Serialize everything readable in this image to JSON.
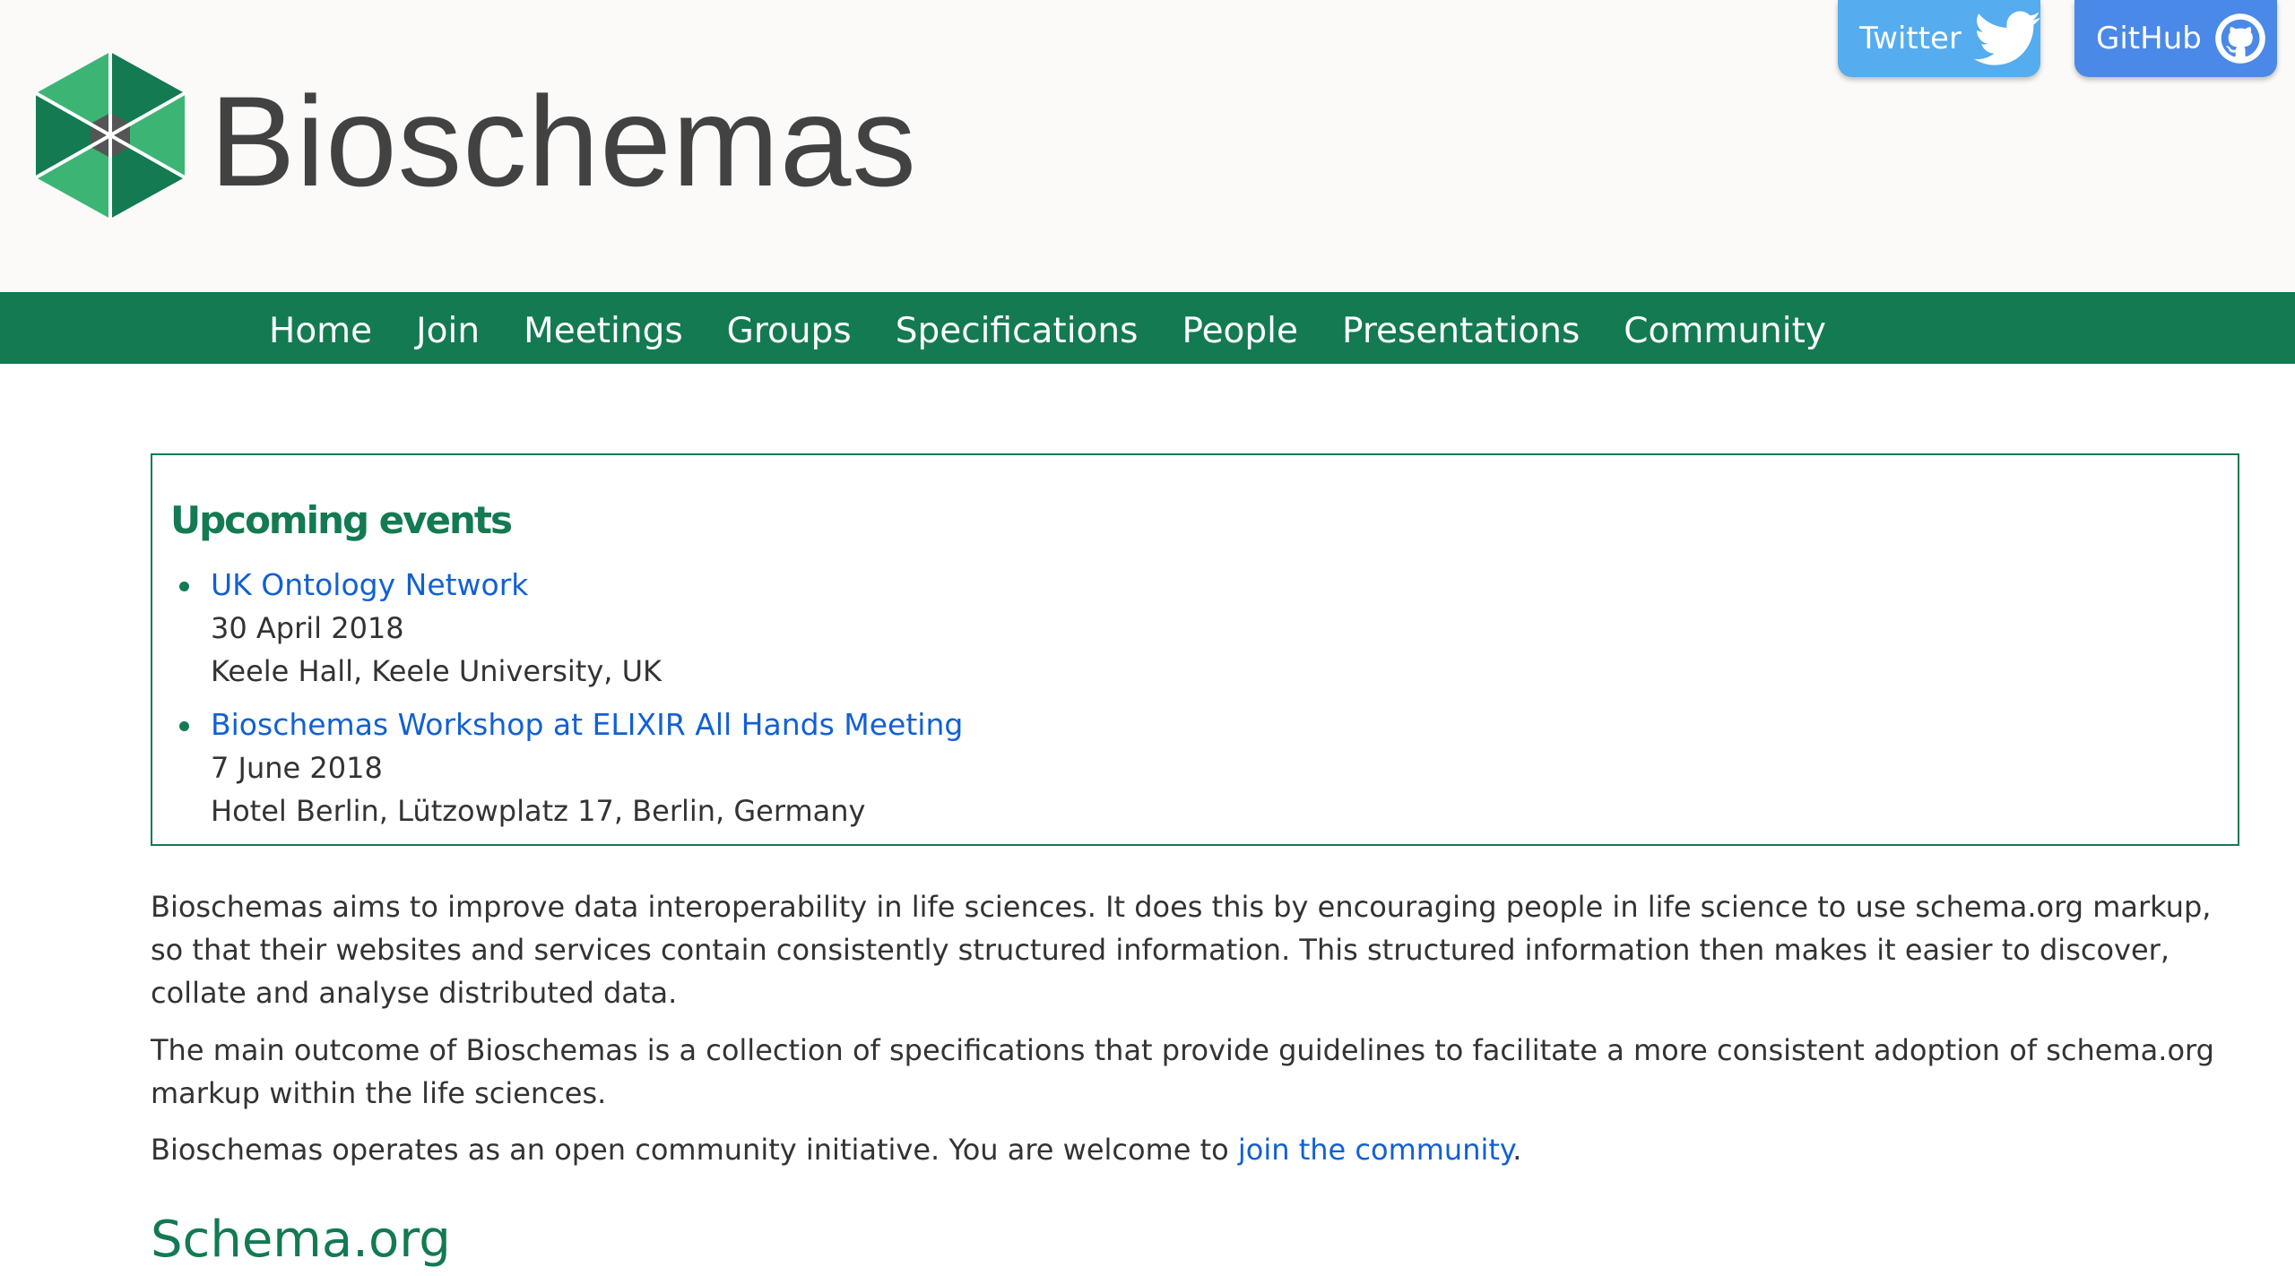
{
  "header": {
    "brand": "Bioschemas",
    "twitter_label": "Twitter",
    "github_label": "GitHub"
  },
  "nav": {
    "items": [
      "Home",
      "Join",
      "Meetings",
      "Groups",
      "Specifications",
      "People",
      "Presentations",
      "Community"
    ]
  },
  "events": {
    "title": "Upcoming events",
    "items": [
      {
        "title": "UK Ontology Network",
        "date": "30 April 2018",
        "location": "Keele Hall, Keele University, UK"
      },
      {
        "title": "Bioschemas Workshop at ELIXIR All Hands Meeting",
        "date": "7 June 2018",
        "location": "Hotel Berlin, Lützowplatz 17, Berlin, Germany"
      }
    ]
  },
  "intro": {
    "p1": "Bioschemas aims to improve data interoperability in life sciences. It does this by encouraging people in life science to use schema.org markup, so that their websites and services contain consistently structured information. This structured information then makes it easier to discover, collate and analyse distributed data.",
    "p2": "The main outcome of Bioschemas is a collection of specifications that provide guidelines to facilitate a more consistent adoption of schema.org markup within the life sciences.",
    "p3_before": "Bioschemas operates as an open community initiative. You are welcome to ",
    "p3_link": "join the community",
    "p3_after": "."
  },
  "section_title": "Schema.org",
  "colors": {
    "brand_green": "#137a52",
    "link_blue": "#1260d4",
    "twitter_blue": "#55acee",
    "github_blue": "#4b89e8",
    "header_bg": "#fbfaf9"
  },
  "icons": {
    "logo": "bioschemas-hexagon-logo",
    "twitter": "twitter-bird-icon",
    "github": "github-octocat-icon"
  }
}
